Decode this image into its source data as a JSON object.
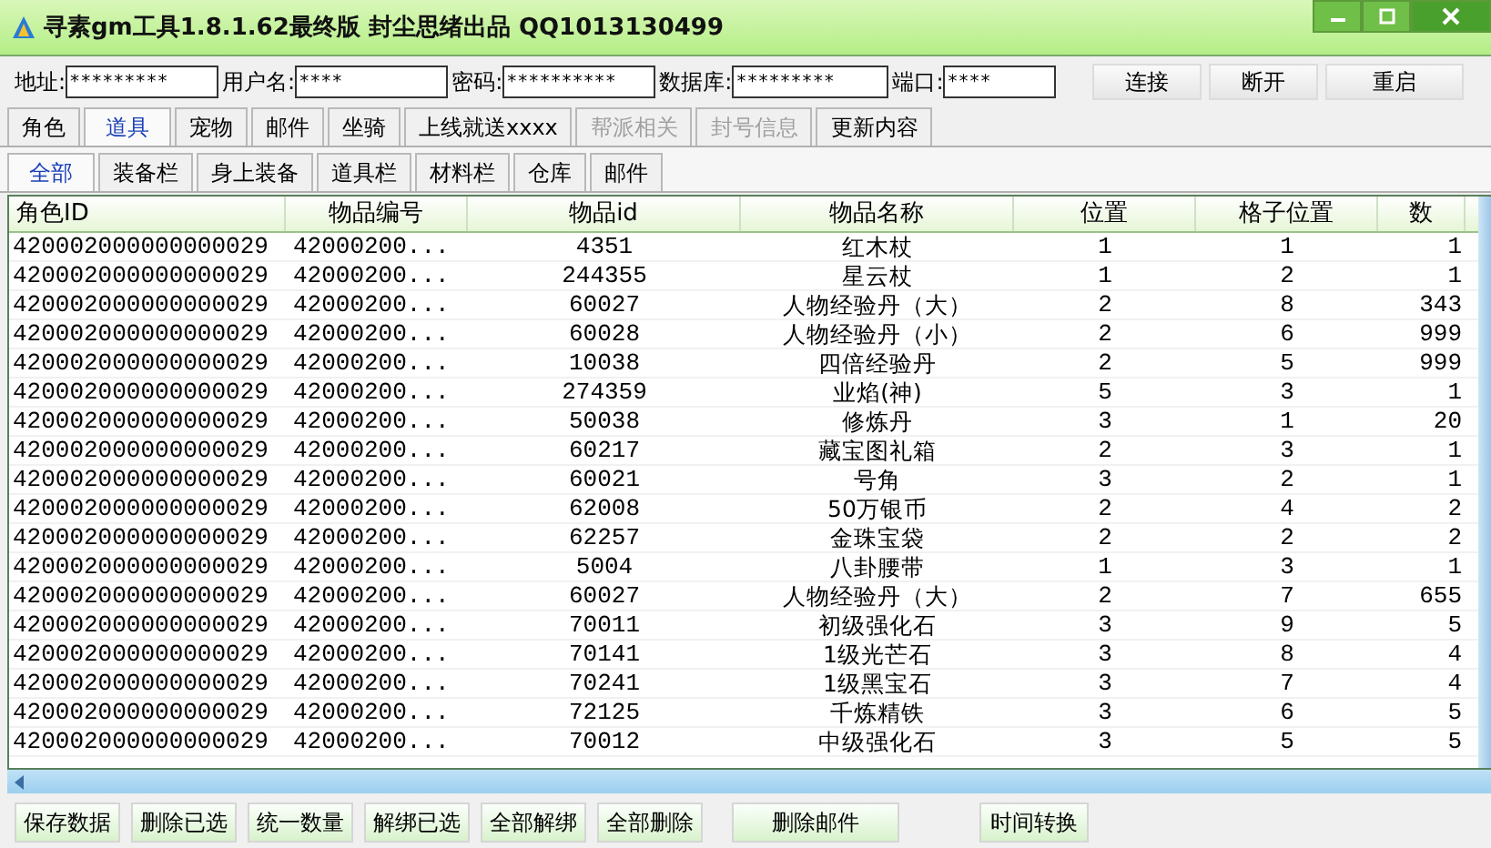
{
  "window": {
    "title": "寻素gm工具1.8.1.62最终版 封尘思绪出品 QQ1013130499"
  },
  "connection": {
    "fields": [
      {
        "label": "地址:",
        "value": "*********"
      },
      {
        "label": "用户名:",
        "value": "****"
      },
      {
        "label": "密码:",
        "value": "**********"
      },
      {
        "label": "数据库:",
        "value": "*********"
      },
      {
        "label": "端口:",
        "value": "****"
      }
    ],
    "buttons": [
      "连接",
      "断开",
      "重启"
    ]
  },
  "tabs": [
    {
      "label": "角色",
      "selected": false,
      "disabled": false
    },
    {
      "label": "道具",
      "selected": true,
      "disabled": false
    },
    {
      "label": "宠物",
      "selected": false,
      "disabled": false
    },
    {
      "label": "邮件",
      "selected": false,
      "disabled": false
    },
    {
      "label": "坐骑",
      "selected": false,
      "disabled": false
    },
    {
      "label": "上线就送xxxx",
      "selected": false,
      "disabled": false
    },
    {
      "label": "帮派相关",
      "selected": false,
      "disabled": true
    },
    {
      "label": "封号信息",
      "selected": false,
      "disabled": true
    },
    {
      "label": "更新内容",
      "selected": false,
      "disabled": false
    }
  ],
  "subtabs": [
    {
      "label": "全部",
      "selected": true
    },
    {
      "label": "装备栏",
      "selected": false
    },
    {
      "label": "身上装备",
      "selected": false
    },
    {
      "label": "道具栏",
      "selected": false
    },
    {
      "label": "材料栏",
      "selected": false
    },
    {
      "label": "仓库",
      "selected": false
    },
    {
      "label": "邮件",
      "selected": false
    }
  ],
  "table": {
    "columns": [
      "角色ID",
      "物品编号",
      "物品id",
      "物品名称",
      "位置",
      "格子位置",
      "数"
    ],
    "rows": [
      [
        "420002000000000029",
        "42000200...",
        "4351",
        "红木杖",
        "1",
        "1",
        "1"
      ],
      [
        "420002000000000029",
        "42000200...",
        "244355",
        "星云杖",
        "1",
        "2",
        "1"
      ],
      [
        "420002000000000029",
        "42000200...",
        "60027",
        "人物经验丹（大）",
        "2",
        "8",
        "343"
      ],
      [
        "420002000000000029",
        "42000200...",
        "60028",
        "人物经验丹（小）",
        "2",
        "6",
        "999"
      ],
      [
        "420002000000000029",
        "42000200...",
        "10038",
        "四倍经验丹",
        "2",
        "5",
        "999"
      ],
      [
        "420002000000000029",
        "42000200...",
        "274359",
        "业焰(神)",
        "5",
        "3",
        "1"
      ],
      [
        "420002000000000029",
        "42000200...",
        "50038",
        "修炼丹",
        "3",
        "1",
        "20"
      ],
      [
        "420002000000000029",
        "42000200...",
        "60217",
        "藏宝图礼箱",
        "2",
        "3",
        "1"
      ],
      [
        "420002000000000029",
        "42000200...",
        "60021",
        "号角",
        "3",
        "2",
        "1"
      ],
      [
        "420002000000000029",
        "42000200...",
        "62008",
        "50万银币",
        "2",
        "4",
        "2"
      ],
      [
        "420002000000000029",
        "42000200...",
        "62257",
        "金珠宝袋",
        "2",
        "2",
        "2"
      ],
      [
        "420002000000000029",
        "42000200...",
        "5004",
        "八卦腰带",
        "1",
        "3",
        "1"
      ],
      [
        "420002000000000029",
        "42000200...",
        "60027",
        "人物经验丹（大）",
        "2",
        "7",
        "655"
      ],
      [
        "420002000000000029",
        "42000200...",
        "70011",
        "初级强化石",
        "3",
        "9",
        "5"
      ],
      [
        "420002000000000029",
        "42000200...",
        "70141",
        "1级光芒石",
        "3",
        "8",
        "4"
      ],
      [
        "420002000000000029",
        "42000200...",
        "70241",
        "1级黑宝石",
        "3",
        "7",
        "4"
      ],
      [
        "420002000000000029",
        "42000200...",
        "72125",
        "千炼精铁",
        "3",
        "6",
        "5"
      ],
      [
        "420002000000000029",
        "42000200...",
        "70012",
        "中级强化石",
        "3",
        "5",
        "5"
      ]
    ]
  },
  "actions": [
    "保存数据",
    "删除已选",
    "统一数量",
    "解绑已选",
    "全部解绑",
    "全部删除",
    "删除邮件",
    "时间转换"
  ]
}
